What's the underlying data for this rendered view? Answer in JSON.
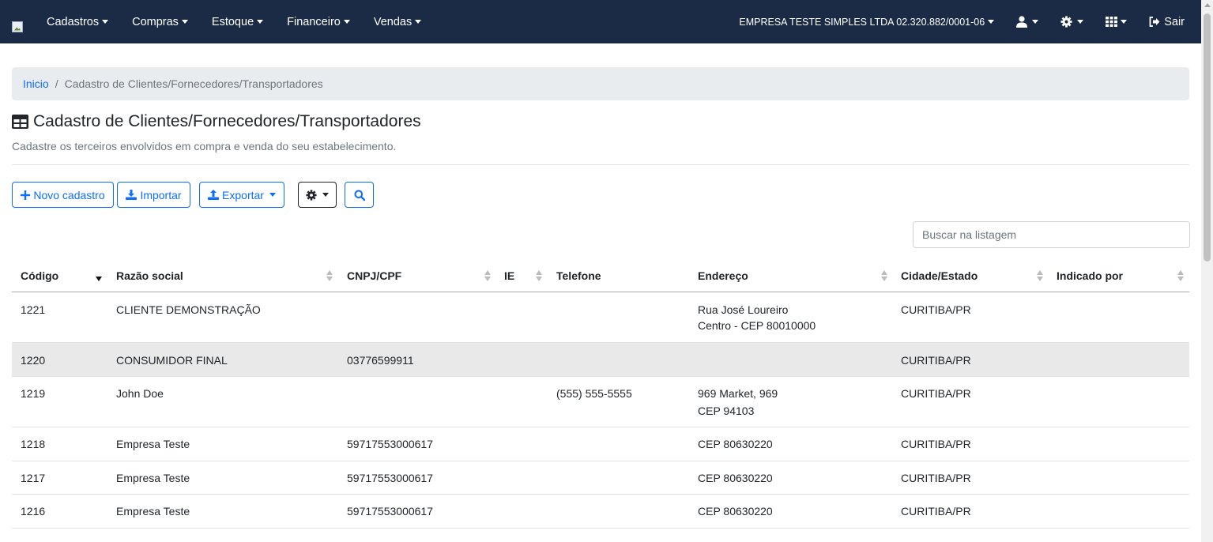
{
  "navbar": {
    "menu": [
      {
        "label": "Cadastros"
      },
      {
        "label": "Compras"
      },
      {
        "label": "Estoque"
      },
      {
        "label": "Financeiro"
      },
      {
        "label": "Vendas"
      }
    ],
    "company": "EMPRESA TESTE SIMPLES LTDA 02.320.882/0001-06",
    "logout_label": "Sair",
    "background_color": "#1b2b46"
  },
  "breadcrumb": {
    "home": "Inicio",
    "current": "Cadastro de Clientes/Fornecedores/Transportadores"
  },
  "page": {
    "title": "Cadastro de Clientes/Fornecedores/Transportadores",
    "subtitle": "Cadastre os terceiros envolvidos em compra e venda do seu estabelecimento."
  },
  "toolbar": {
    "new_label": "Novo cadastro",
    "import_label": "Importar",
    "export_label": "Exportar",
    "accent_color": "#0d6efd"
  },
  "search": {
    "placeholder": "Buscar na listagem",
    "value": ""
  },
  "table": {
    "columns": [
      "Código",
      "Razão social",
      "CNPJ/CPF",
      "IE",
      "Telefone",
      "Endereço",
      "Cidade/Estado",
      "Indicado por"
    ],
    "rows": [
      {
        "codigo": "1221",
        "razao": "CLIENTE DEMONSTRAÇÃO",
        "cnpj": "",
        "ie": "",
        "telefone": "",
        "endereco1": "Rua José Loureiro",
        "endereco2": "Centro - CEP 80010000",
        "cidade": "CURITIBA/PR",
        "indicado": ""
      },
      {
        "codigo": "1220",
        "razao": "CONSUMIDOR FINAL",
        "cnpj": "03776599911",
        "ie": "",
        "telefone": "",
        "endereco1": "",
        "endereco2": "",
        "cidade": "CURITIBA/PR",
        "indicado": ""
      },
      {
        "codigo": "1219",
        "razao": "John Doe",
        "cnpj": "",
        "ie": "",
        "telefone": "(555) 555-5555",
        "endereco1": "969 Market, 969",
        "endereco2": "CEP 94103",
        "cidade": "CURITIBA/PR",
        "indicado": ""
      },
      {
        "codigo": "1218",
        "razao": "Empresa Teste",
        "cnpj": "59717553000617",
        "ie": "",
        "telefone": "",
        "endereco1": "CEP 80630220",
        "endereco2": "",
        "cidade": "CURITIBA/PR",
        "indicado": ""
      },
      {
        "codigo": "1217",
        "razao": "Empresa Teste",
        "cnpj": "59717553000617",
        "ie": "",
        "telefone": "",
        "endereco1": "CEP 80630220",
        "endereco2": "",
        "cidade": "CURITIBA/PR",
        "indicado": ""
      },
      {
        "codigo": "1216",
        "razao": "Empresa Teste",
        "cnpj": "59717553000617",
        "ie": "",
        "telefone": "",
        "endereco1": "CEP 80630220",
        "endereco2": "",
        "cidade": "CURITIBA/PR",
        "indicado": ""
      }
    ]
  }
}
